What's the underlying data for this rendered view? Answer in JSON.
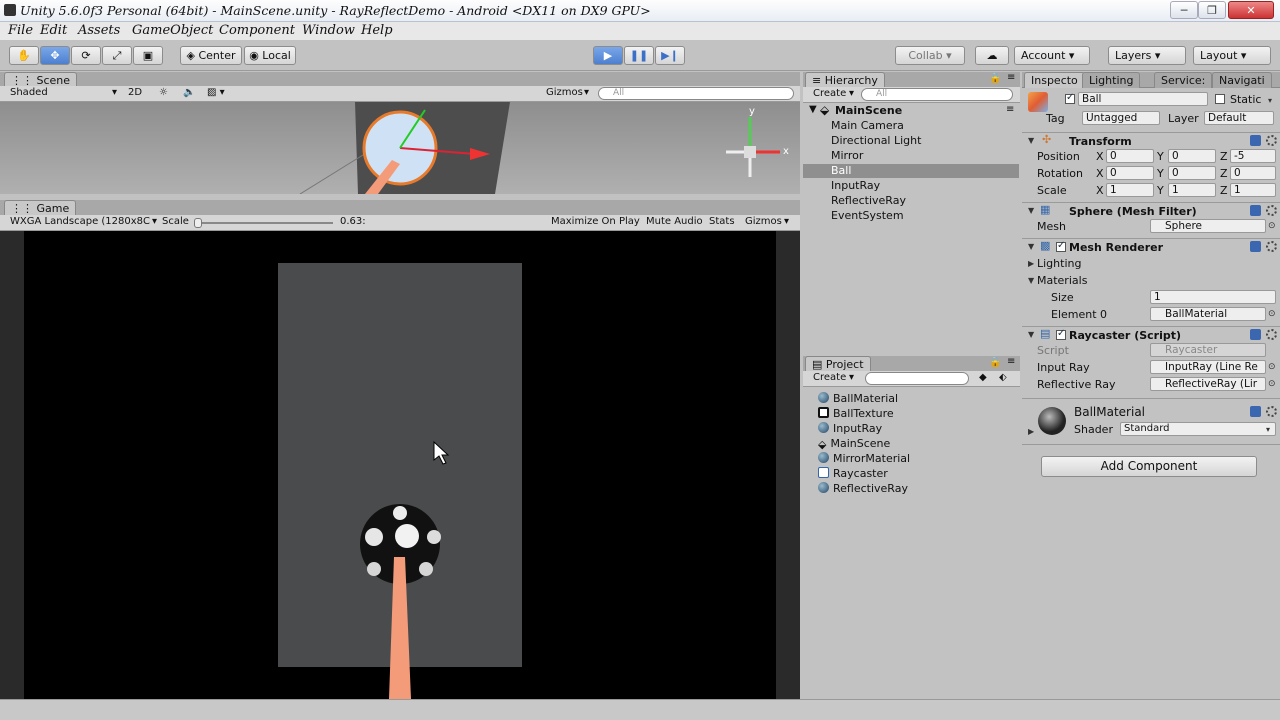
{
  "window": {
    "title": "Unity 5.6.0f3 Personal (64bit) - MainScene.unity - RayReflectDemo - Android <DX11 on DX9 GPU>",
    "minimize": "─",
    "maximize": "❐",
    "close": "✕"
  },
  "menu": [
    "File",
    "Edit",
    "Assets",
    "GameObject",
    "Component",
    "Window",
    "Help"
  ],
  "toolbar": {
    "center": "Center",
    "local": "Local",
    "collab": "Collab ▾",
    "account": "Account",
    "layers": "Layers",
    "layout": "Layout"
  },
  "scene": {
    "tab": "Scene",
    "shading": "Shaded",
    "mode2d": "2D",
    "gizmos": "Gizmos",
    "search_placeholder": "All",
    "axis_y": "y",
    "axis_x": "x"
  },
  "game": {
    "tab": "Game",
    "resolution": "WXGA Landscape (1280x8C",
    "scale_label": "Scale",
    "scale_value": "0.63:",
    "maximize": "Maximize On Play",
    "mute": "Mute Audio",
    "stats": "Stats",
    "gizmos": "Gizmos"
  },
  "hierarchy": {
    "tab": "Hierarchy",
    "create": "Create",
    "search_placeholder": "All",
    "scene_name": "MainScene",
    "items": [
      "Main Camera",
      "Directional Light",
      "Mirror",
      "Ball",
      "InputRay",
      "ReflectiveRay",
      "EventSystem"
    ],
    "selected_index": 3
  },
  "project": {
    "tab": "Project",
    "create": "Create",
    "items": [
      "BallMaterial",
      "BallTexture",
      "InputRay",
      "MainScene",
      "MirrorMaterial",
      "Raycaster",
      "ReflectiveRay"
    ]
  },
  "inspector": {
    "tabs": [
      "Inspecto",
      "Lighting",
      "Service:",
      "Navigati"
    ],
    "object_name": "Ball",
    "static_label": "Static",
    "tag_label": "Tag",
    "tag_value": "Untagged",
    "layer_label": "Layer",
    "layer_value": "Default",
    "transform": {
      "title": "Transform",
      "position_label": "Position",
      "rotation_label": "Rotation",
      "scale_label": "Scale",
      "position": [
        "0",
        "0",
        "-5"
      ],
      "rotation": [
        "0",
        "0",
        "0"
      ],
      "scale": [
        "1",
        "1",
        "1"
      ],
      "axis_labels": [
        "X",
        "Y",
        "Z"
      ]
    },
    "mesh_filter": {
      "title": "Sphere (Mesh Filter)",
      "mesh_label": "Mesh",
      "mesh_value": "Sphere"
    },
    "mesh_renderer": {
      "title": "Mesh Renderer",
      "lighting": "Lighting",
      "materials": "Materials",
      "size_label": "Size",
      "size_value": "1",
      "element_label": "Element 0",
      "element_value": "BallMaterial"
    },
    "raycaster": {
      "title": "Raycaster (Script)",
      "script_label": "Script",
      "script_value": "Raycaster",
      "input_ray_label": "Input Ray",
      "input_ray_value": "InputRay (Line Re",
      "reflective_ray_label": "Reflective Ray",
      "reflective_ray_value": "ReflectiveRay (Lir"
    },
    "material": {
      "name": "BallMaterial",
      "shader_label": "Shader",
      "shader_value": "Standard"
    },
    "add_component": "Add Component"
  },
  "colors": {
    "ray": "#f49b7a",
    "play_accent": "#4c7fd0",
    "panel": "#c2c2c2"
  }
}
